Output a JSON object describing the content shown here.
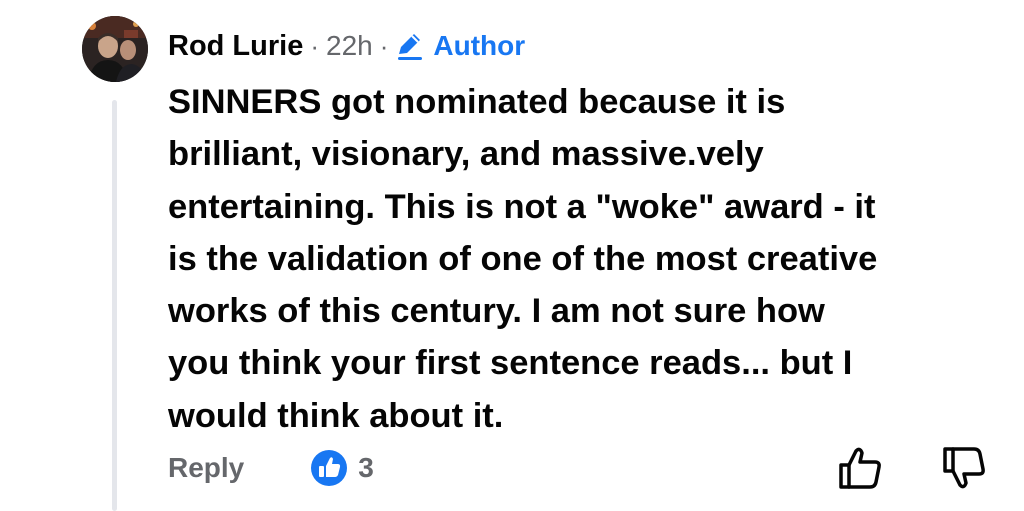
{
  "comment": {
    "author": "Rod Lurie",
    "separator": "·",
    "time": "22h",
    "badge_label": "Author",
    "body": "SINNERS got nominated because it is\nbrilliant, visionary, and massive.vely\nentertaining.  This is not a \"woke\" award - it\nis the validation of one of the most creative\nworks of this century.  I am not sure how\nyou think your first sentence reads... but I\nwould think about it.",
    "reply_label": "Reply",
    "like_count": "3"
  },
  "icons": {
    "badge": "pencil-icon",
    "reaction": "like-reaction-icon",
    "upvote": "thumbs-up-icon",
    "downvote": "thumbs-down-icon"
  },
  "colors": {
    "text": "#050505",
    "secondary_text": "#65676b",
    "accent": "#1877f2",
    "thread_line": "#e4e6eb"
  }
}
